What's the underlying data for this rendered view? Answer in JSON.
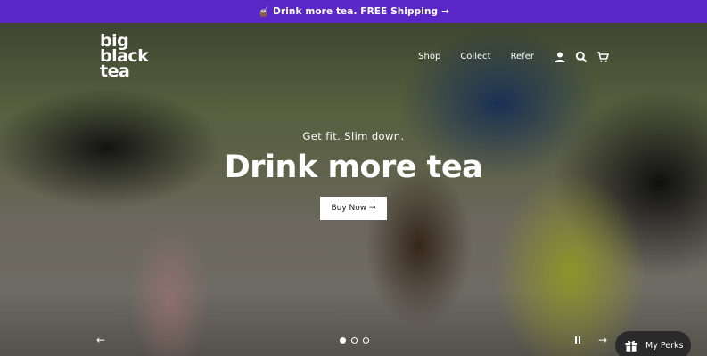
{
  "announcement": {
    "emoji": "🧉",
    "text": "Drink more tea. FREE Shipping",
    "arrow": "→"
  },
  "logo": {
    "line1": "big",
    "line2": "black",
    "line3": "tea"
  },
  "nav": {
    "items": [
      "Shop",
      "Collect",
      "Refer"
    ],
    "icons": [
      "account-icon",
      "search-icon",
      "cart-icon"
    ]
  },
  "hero": {
    "subtitle": "Get fit. Slim down.",
    "headline": "Drink more tea",
    "cta_label": "Buy Now →"
  },
  "slider": {
    "prev": "←",
    "next": "→",
    "dots": 3,
    "active_index": 0
  },
  "perks": {
    "label": "My Perks",
    "icon": "gift-icon"
  },
  "colors": {
    "announcement_bg": "#5b26c6",
    "perks_bg": "#2a2a2a"
  }
}
